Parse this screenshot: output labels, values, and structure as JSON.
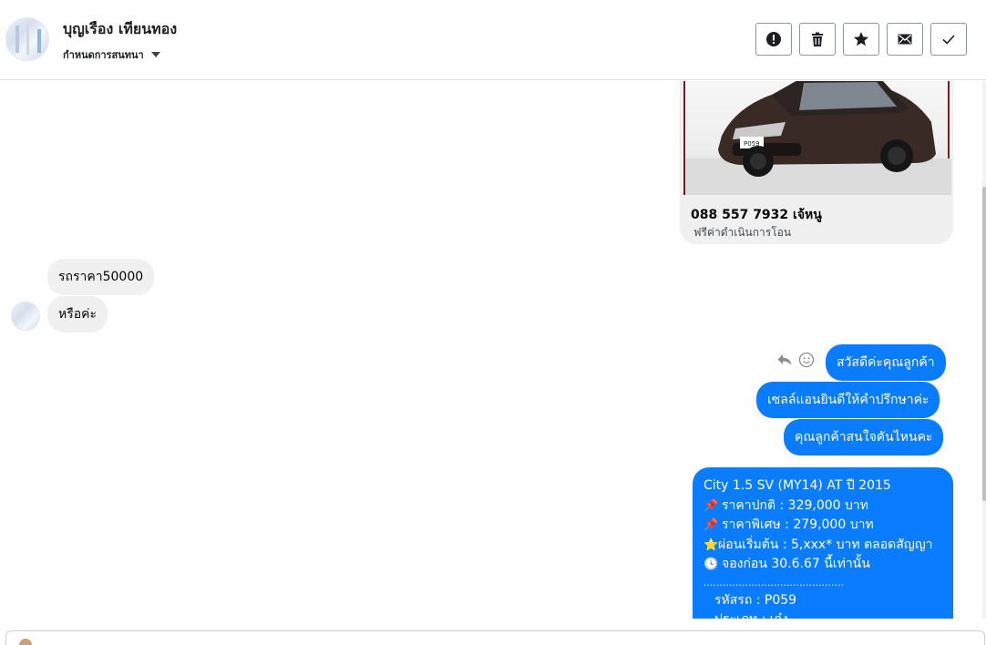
{
  "header": {
    "contact_name": "บุญเรือง เทียนทอง",
    "subtitle": "กำหนดการสนทนา",
    "actions": [
      {
        "name": "report-button",
        "icon": "alert-icon",
        "title": "!"
      },
      {
        "name": "delete-button",
        "icon": "trash-icon"
      },
      {
        "name": "star-button",
        "icon": "star-icon"
      },
      {
        "name": "mark-unread-button",
        "icon": "mail-icon"
      },
      {
        "name": "done-button",
        "icon": "check-icon"
      }
    ]
  },
  "messages": {
    "card": {
      "line1": "088 557 7932 เจ้หนู",
      "line2": "ฟรีค่าดำเนินการโอน",
      "plate_text": "P059"
    },
    "incoming": [
      "รถราคา50000",
      "หรือค่ะ"
    ],
    "outgoing": [
      "สวัสดีค่ะคุณลูกค้า",
      "เซลล์แอนยินดีให้คำปรึกษาค่ะ",
      "คุณลูกค้าสนใจคันไหนคะ"
    ],
    "long_message": {
      "title": "City 1.5 SV (MY14) AT ปี 2015",
      "price_normal": "ราคาปกติ : 329,000 บาท",
      "price_special": "ราคาพิเศษ : 279,000 บาท",
      "installment": "ผ่อนเริ่มต้น : 5,xxx* บาท ตลอดสัญญา",
      "deadline": "จองก่อน 30.6.67 นี้เท่านั้น",
      "divider": "............................................",
      "car_code": "รหัสรถ : P059",
      "partial_line": "ประเภท : เก๋ง"
    }
  },
  "colors": {
    "outgoing_bubble": "#0a7cff",
    "incoming_bubble": "#f0f0f0"
  }
}
